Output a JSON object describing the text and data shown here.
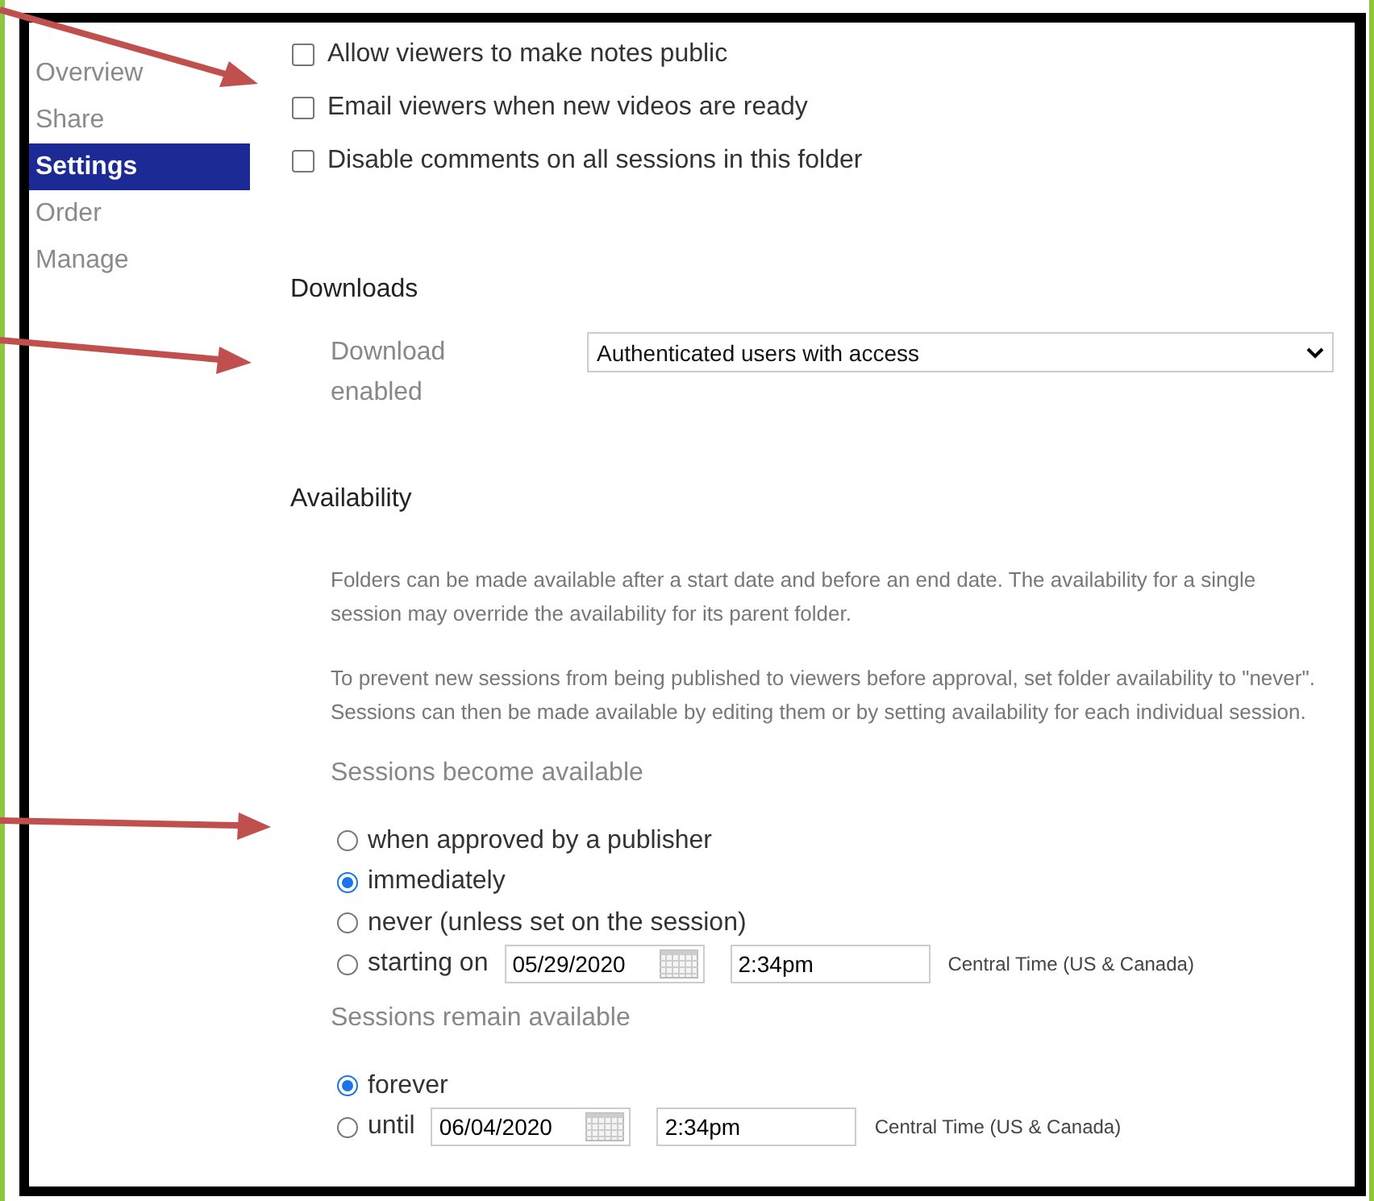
{
  "sidebar": {
    "items": [
      {
        "label": "Overview",
        "selected": false
      },
      {
        "label": "Share",
        "selected": false
      },
      {
        "label": "Settings",
        "selected": true
      },
      {
        "label": "Order",
        "selected": false
      },
      {
        "label": "Manage",
        "selected": false
      }
    ]
  },
  "options": [
    {
      "label": "Allow viewers to make notes public",
      "checked": false
    },
    {
      "label": "Email viewers when new videos are ready",
      "checked": false
    },
    {
      "label": "Disable comments on all sessions in this folder",
      "checked": false
    }
  ],
  "downloads": {
    "heading": "Downloads",
    "label": "Download enabled",
    "value": "Authenticated users with access"
  },
  "availability": {
    "heading": "Availability",
    "paragraphs": [
      "Folders can be made available after a start date and before an end date. The availability for a single session may override the availability for its parent folder.",
      "To prevent new sessions from being published to viewers before approval, set folder availability to \"never\". Sessions can then be made available by editing them or by setting availability for each individual session."
    ],
    "groups": [
      {
        "label": "Sessions become available",
        "options": [
          {
            "kind": "plain",
            "label": "when approved by a publisher",
            "selected": false
          },
          {
            "kind": "plain",
            "label": "immediately",
            "selected": true
          },
          {
            "kind": "plain",
            "label": "never (unless set on the session)",
            "selected": false
          },
          {
            "kind": "datetime",
            "label": "starting on",
            "date": "05/29/2020",
            "time": "2:34pm",
            "timezone": "Central Time (US & Canada)",
            "selected": false
          }
        ]
      },
      {
        "label": "Sessions remain available",
        "options": [
          {
            "kind": "plain",
            "label": "forever",
            "selected": true
          },
          {
            "kind": "datetime",
            "label": "until",
            "date": "06/04/2020",
            "time": "2:34pm",
            "timezone": "Central Time (US & Canada)",
            "selected": false
          }
        ]
      }
    ]
  }
}
